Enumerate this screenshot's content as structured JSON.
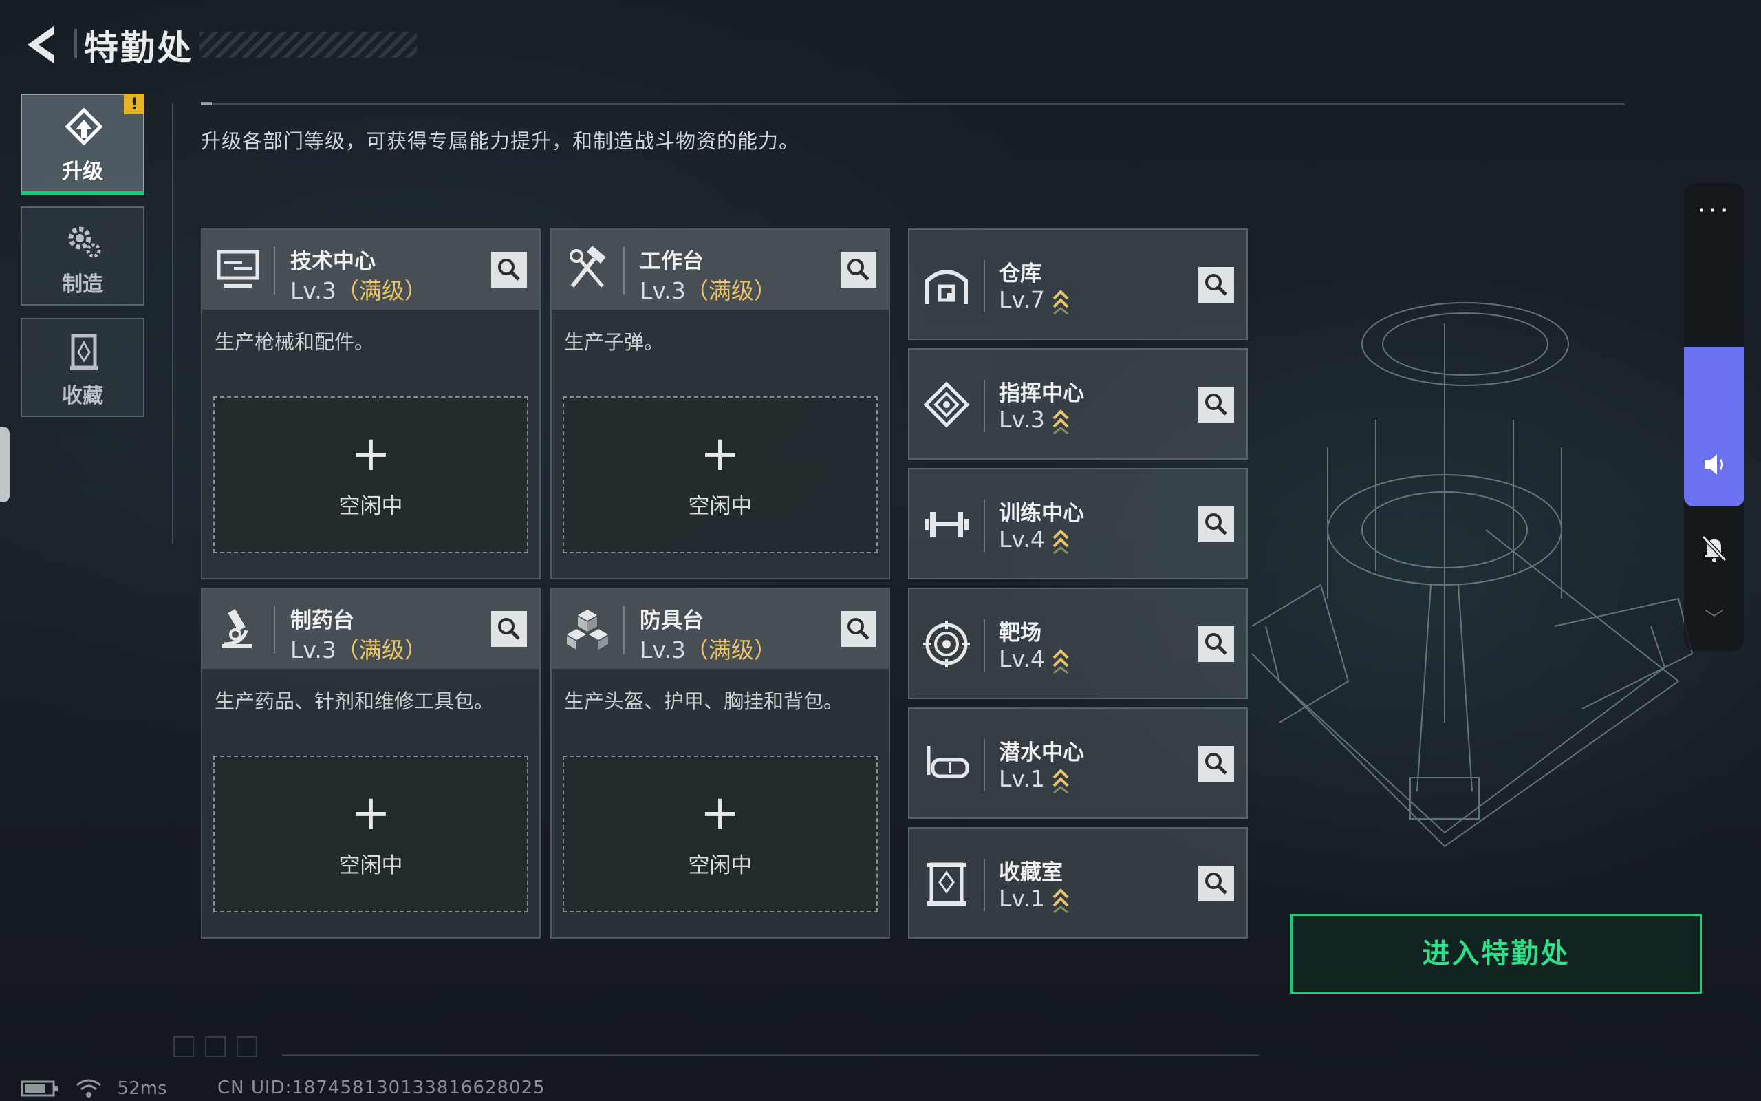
{
  "header": {
    "title": "特勤处"
  },
  "nav": [
    {
      "label": "升级",
      "icon": "upgrade-icon",
      "active": true,
      "badge": "!"
    },
    {
      "label": "制造",
      "icon": "gears-icon",
      "active": false
    },
    {
      "label": "收藏",
      "icon": "trophy-icon",
      "active": false
    }
  ],
  "description": "升级各部门等级，可获得专属能力提升，和制造战斗物资的能力。",
  "departments_main": [
    {
      "name": "技术中心",
      "level": "Lv.3",
      "max_label": "（满级）",
      "desc": "生产枪械和配件。",
      "slot_status": "空闲中",
      "slot_plus": "+",
      "icon": "monitor-icon"
    },
    {
      "name": "工作台",
      "level": "Lv.3",
      "max_label": "（满级）",
      "desc": "生产子弹。",
      "slot_status": "空闲中",
      "slot_plus": "+",
      "icon": "hammer-wrench-icon"
    },
    {
      "name": "制药台",
      "level": "Lv.3",
      "max_label": "（满级）",
      "desc": "生产药品、针剂和维修工具包。",
      "slot_status": "空闲中",
      "slot_plus": "+",
      "icon": "microscope-icon"
    },
    {
      "name": "防具台",
      "level": "Lv.3",
      "max_label": "（满级）",
      "desc": "生产头盔、护甲、胸挂和背包。",
      "slot_status": "空闲中",
      "slot_plus": "+",
      "icon": "armor-boxes-icon"
    }
  ],
  "departments_side": [
    {
      "name": "仓库",
      "level": "Lv.7",
      "icon": "warehouse-icon"
    },
    {
      "name": "指挥中心",
      "level": "Lv.3",
      "icon": "command-icon"
    },
    {
      "name": "训练中心",
      "level": "Lv.4",
      "icon": "dumbbell-icon"
    },
    {
      "name": "靶场",
      "level": "Lv.4",
      "icon": "target-icon"
    },
    {
      "name": "潜水中心",
      "level": "Lv.1",
      "icon": "diving-mask-icon"
    },
    {
      "name": "收藏室",
      "level": "Lv.1",
      "icon": "trophy-room-icon"
    }
  ],
  "enter_button": "进入特勤处",
  "right_panel": {
    "more": "···",
    "chevron": "﹀"
  },
  "status": {
    "ping": "52ms",
    "uid": "CN UID:187458130133816628025"
  },
  "colors": {
    "accent_green": "#25c47b",
    "max_level": "#e9c46a",
    "volume": "#6a72f0",
    "badge": "#e6b422"
  }
}
